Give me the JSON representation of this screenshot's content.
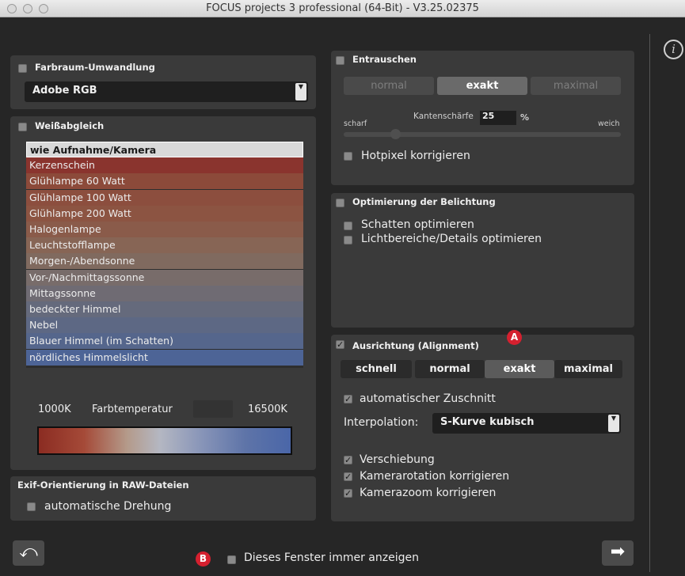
{
  "window": {
    "title": "FOCUS projects 3 professional (64-Bit) - V3.25.02375"
  },
  "color_conversion": {
    "header": "Farbraum-Umwandlung",
    "selected": "Adobe RGB"
  },
  "white_balance": {
    "header": "Weißabgleich",
    "items": [
      {
        "label": "wie Aufnahme/Kamera",
        "color": "#d9d9d9",
        "selected": true
      },
      {
        "label": "Kerzenschein",
        "color": "#8a342e"
      },
      {
        "label": "Glühlampe 60 Watt",
        "color": "#8c4a3a"
      },
      {
        "label": "Glühlampe 100 Watt",
        "color": "#8c4e3e"
      },
      {
        "label": "Glühlampe 200 Watt",
        "color": "#8c5442"
      },
      {
        "label": "Halogenlampe",
        "color": "#8a5b4a"
      },
      {
        "label": "Leuchtstofflampe",
        "color": "#876555"
      },
      {
        "label": "Morgen-/Abendsonne",
        "color": "#806a5f"
      },
      {
        "label": "Vor-/Nachmittagssonne",
        "color": "#786c6a"
      },
      {
        "label": "Mittagssonne",
        "color": "#6f6b73"
      },
      {
        "label": "bedeckter Himmel",
        "color": "#656a7c"
      },
      {
        "label": "Nebel",
        "color": "#5d6884"
      },
      {
        "label": "Blauer Himmel (im Schatten)",
        "color": "#55668c"
      },
      {
        "label": "nördliches Himmelslicht",
        "color": "#4d6496"
      }
    ],
    "temp_min": "1000K",
    "temp_label": "Farbtemperatur",
    "temp_max": "16500K"
  },
  "exif": {
    "header": "Exif-Orientierung in RAW-Dateien",
    "auto_rotate": "automatische Drehung"
  },
  "denoise": {
    "header": "Entrauschen",
    "modes": [
      "normal",
      "exakt",
      "maximal"
    ],
    "selected_mode": "exakt",
    "sharp_label": "scharf",
    "soft_label": "weich",
    "edge_label": "Kantenschärfe",
    "edge_value": "25",
    "edge_unit": "%",
    "hotpixel": "Hotpixel korrigieren"
  },
  "exposure": {
    "header": "Optimierung der Belichtung",
    "shadows": "Schatten optimieren",
    "highlights": "Lichtbereiche/Details optimieren"
  },
  "alignment": {
    "header": "Ausrichtung (Alignment)",
    "modes": [
      "schnell",
      "normal",
      "exakt",
      "maximal"
    ],
    "selected_mode": "exakt",
    "auto_crop": "automatischer Zuschnitt",
    "interp_label": "Interpolation:",
    "interp_value": "S-Kurve kubisch",
    "shift": "Verschiebung",
    "rotation": "Kamerarotation korrigieren",
    "zoom": "Kamerazoom korrigieren",
    "badge": "A"
  },
  "footer": {
    "always_show": "Dieses Fenster immer anzeigen",
    "badge": "B"
  },
  "icons": {
    "info": "info-icon",
    "back": "undo-arrow-icon",
    "next": "right-arrow-icon"
  }
}
